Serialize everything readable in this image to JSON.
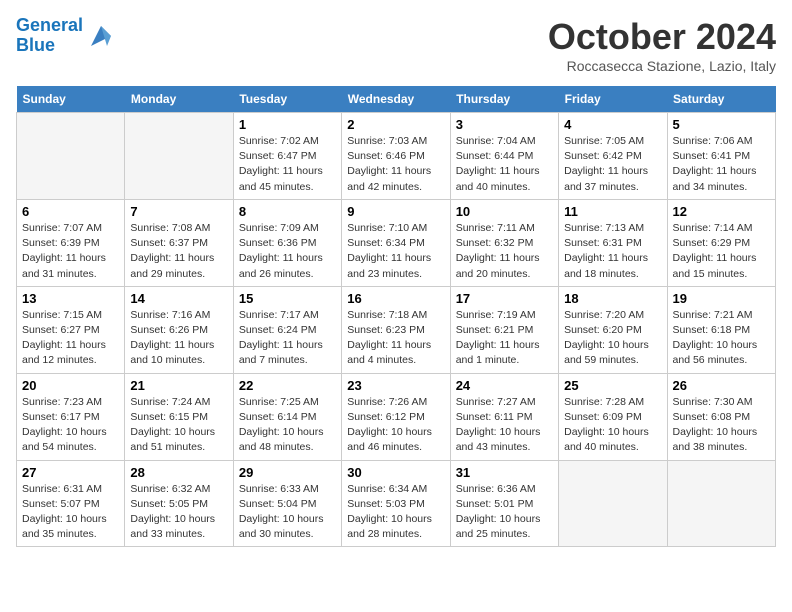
{
  "header": {
    "logo_line1": "General",
    "logo_line2": "Blue",
    "month": "October 2024",
    "location": "Roccasecca Stazione, Lazio, Italy"
  },
  "weekdays": [
    "Sunday",
    "Monday",
    "Tuesday",
    "Wednesday",
    "Thursday",
    "Friday",
    "Saturday"
  ],
  "weeks": [
    [
      {
        "day": "",
        "info": ""
      },
      {
        "day": "",
        "info": ""
      },
      {
        "day": "1",
        "info": "Sunrise: 7:02 AM\nSunset: 6:47 PM\nDaylight: 11 hours and 45 minutes."
      },
      {
        "day": "2",
        "info": "Sunrise: 7:03 AM\nSunset: 6:46 PM\nDaylight: 11 hours and 42 minutes."
      },
      {
        "day": "3",
        "info": "Sunrise: 7:04 AM\nSunset: 6:44 PM\nDaylight: 11 hours and 40 minutes."
      },
      {
        "day": "4",
        "info": "Sunrise: 7:05 AM\nSunset: 6:42 PM\nDaylight: 11 hours and 37 minutes."
      },
      {
        "day": "5",
        "info": "Sunrise: 7:06 AM\nSunset: 6:41 PM\nDaylight: 11 hours and 34 minutes."
      }
    ],
    [
      {
        "day": "6",
        "info": "Sunrise: 7:07 AM\nSunset: 6:39 PM\nDaylight: 11 hours and 31 minutes."
      },
      {
        "day": "7",
        "info": "Sunrise: 7:08 AM\nSunset: 6:37 PM\nDaylight: 11 hours and 29 minutes."
      },
      {
        "day": "8",
        "info": "Sunrise: 7:09 AM\nSunset: 6:36 PM\nDaylight: 11 hours and 26 minutes."
      },
      {
        "day": "9",
        "info": "Sunrise: 7:10 AM\nSunset: 6:34 PM\nDaylight: 11 hours and 23 minutes."
      },
      {
        "day": "10",
        "info": "Sunrise: 7:11 AM\nSunset: 6:32 PM\nDaylight: 11 hours and 20 minutes."
      },
      {
        "day": "11",
        "info": "Sunrise: 7:13 AM\nSunset: 6:31 PM\nDaylight: 11 hours and 18 minutes."
      },
      {
        "day": "12",
        "info": "Sunrise: 7:14 AM\nSunset: 6:29 PM\nDaylight: 11 hours and 15 minutes."
      }
    ],
    [
      {
        "day": "13",
        "info": "Sunrise: 7:15 AM\nSunset: 6:27 PM\nDaylight: 11 hours and 12 minutes."
      },
      {
        "day": "14",
        "info": "Sunrise: 7:16 AM\nSunset: 6:26 PM\nDaylight: 11 hours and 10 minutes."
      },
      {
        "day": "15",
        "info": "Sunrise: 7:17 AM\nSunset: 6:24 PM\nDaylight: 11 hours and 7 minutes."
      },
      {
        "day": "16",
        "info": "Sunrise: 7:18 AM\nSunset: 6:23 PM\nDaylight: 11 hours and 4 minutes."
      },
      {
        "day": "17",
        "info": "Sunrise: 7:19 AM\nSunset: 6:21 PM\nDaylight: 11 hours and 1 minute."
      },
      {
        "day": "18",
        "info": "Sunrise: 7:20 AM\nSunset: 6:20 PM\nDaylight: 10 hours and 59 minutes."
      },
      {
        "day": "19",
        "info": "Sunrise: 7:21 AM\nSunset: 6:18 PM\nDaylight: 10 hours and 56 minutes."
      }
    ],
    [
      {
        "day": "20",
        "info": "Sunrise: 7:23 AM\nSunset: 6:17 PM\nDaylight: 10 hours and 54 minutes."
      },
      {
        "day": "21",
        "info": "Sunrise: 7:24 AM\nSunset: 6:15 PM\nDaylight: 10 hours and 51 minutes."
      },
      {
        "day": "22",
        "info": "Sunrise: 7:25 AM\nSunset: 6:14 PM\nDaylight: 10 hours and 48 minutes."
      },
      {
        "day": "23",
        "info": "Sunrise: 7:26 AM\nSunset: 6:12 PM\nDaylight: 10 hours and 46 minutes."
      },
      {
        "day": "24",
        "info": "Sunrise: 7:27 AM\nSunset: 6:11 PM\nDaylight: 10 hours and 43 minutes."
      },
      {
        "day": "25",
        "info": "Sunrise: 7:28 AM\nSunset: 6:09 PM\nDaylight: 10 hours and 40 minutes."
      },
      {
        "day": "26",
        "info": "Sunrise: 7:30 AM\nSunset: 6:08 PM\nDaylight: 10 hours and 38 minutes."
      }
    ],
    [
      {
        "day": "27",
        "info": "Sunrise: 6:31 AM\nSunset: 5:07 PM\nDaylight: 10 hours and 35 minutes."
      },
      {
        "day": "28",
        "info": "Sunrise: 6:32 AM\nSunset: 5:05 PM\nDaylight: 10 hours and 33 minutes."
      },
      {
        "day": "29",
        "info": "Sunrise: 6:33 AM\nSunset: 5:04 PM\nDaylight: 10 hours and 30 minutes."
      },
      {
        "day": "30",
        "info": "Sunrise: 6:34 AM\nSunset: 5:03 PM\nDaylight: 10 hours and 28 minutes."
      },
      {
        "day": "31",
        "info": "Sunrise: 6:36 AM\nSunset: 5:01 PM\nDaylight: 10 hours and 25 minutes."
      },
      {
        "day": "",
        "info": ""
      },
      {
        "day": "",
        "info": ""
      }
    ]
  ]
}
